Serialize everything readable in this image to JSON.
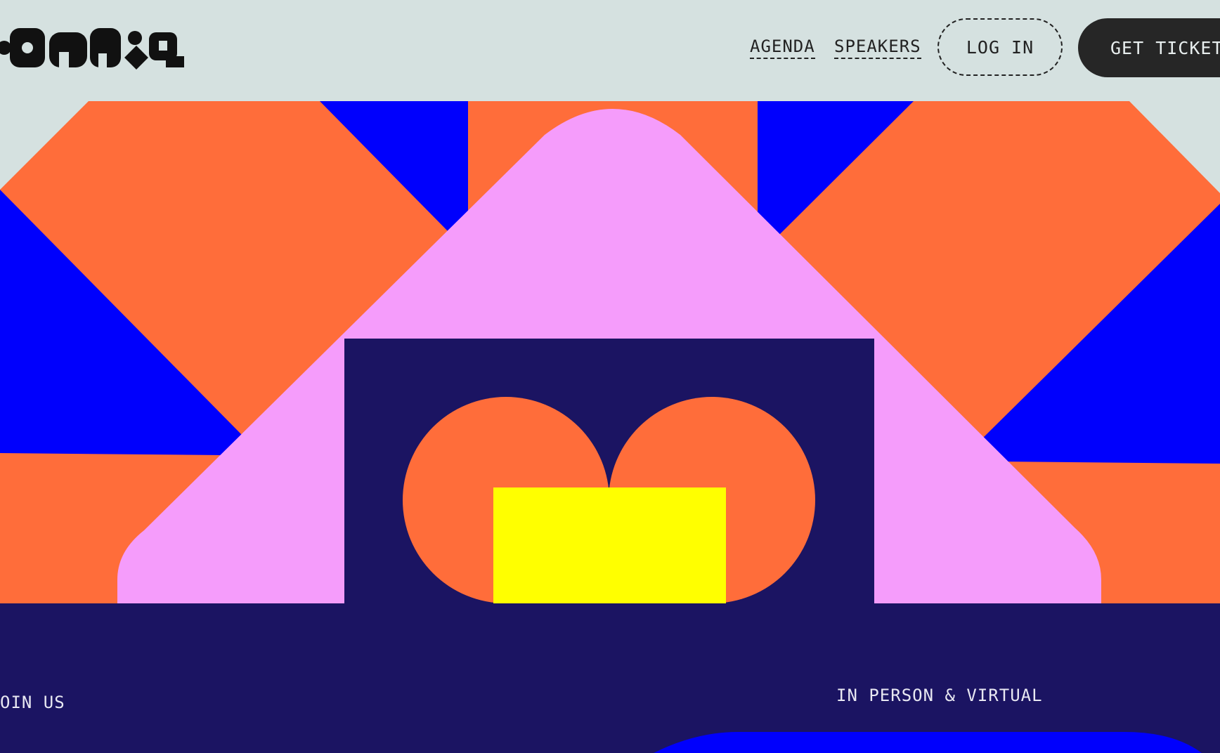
{
  "brand": {
    "logo_text": "config"
  },
  "nav": {
    "agenda_label": "AGENDA",
    "speakers_label": "SPEAKERS",
    "login_label": "LOG IN",
    "tickets_label": "GET TICKETS"
  },
  "hero": {
    "join_text": "OIN US",
    "format_text": "IN PERSON & VIRTUAL"
  },
  "colors": {
    "background": "#d5e1e0",
    "orange": "#ff6d3a",
    "blue": "#0000fd",
    "pink": "#f59cfb",
    "navy": "#1b1462",
    "yellow": "#ffff00",
    "dark": "#262626"
  }
}
